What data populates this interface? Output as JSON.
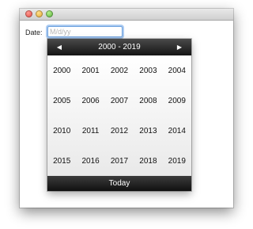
{
  "form": {
    "date_label": "Date:",
    "date_placeholder": "M/d/yy",
    "date_value": ""
  },
  "picker": {
    "range_title": "2000 - 2019",
    "prev_icon": "◀",
    "next_icon": "▶",
    "years": [
      "2000",
      "2001",
      "2002",
      "2003",
      "2004",
      "2005",
      "2006",
      "2007",
      "2008",
      "2009",
      "2010",
      "2011",
      "2012",
      "2013",
      "2014",
      "2015",
      "2016",
      "2017",
      "2018",
      "2019"
    ],
    "today_label": "Today"
  },
  "colors": {
    "focus_ring": "#6fa3e0",
    "header_bg": "#2a2a2a",
    "close_button": "#e0443a",
    "minimize_button": "#e0a12a",
    "zoom_button": "#4ea936"
  }
}
